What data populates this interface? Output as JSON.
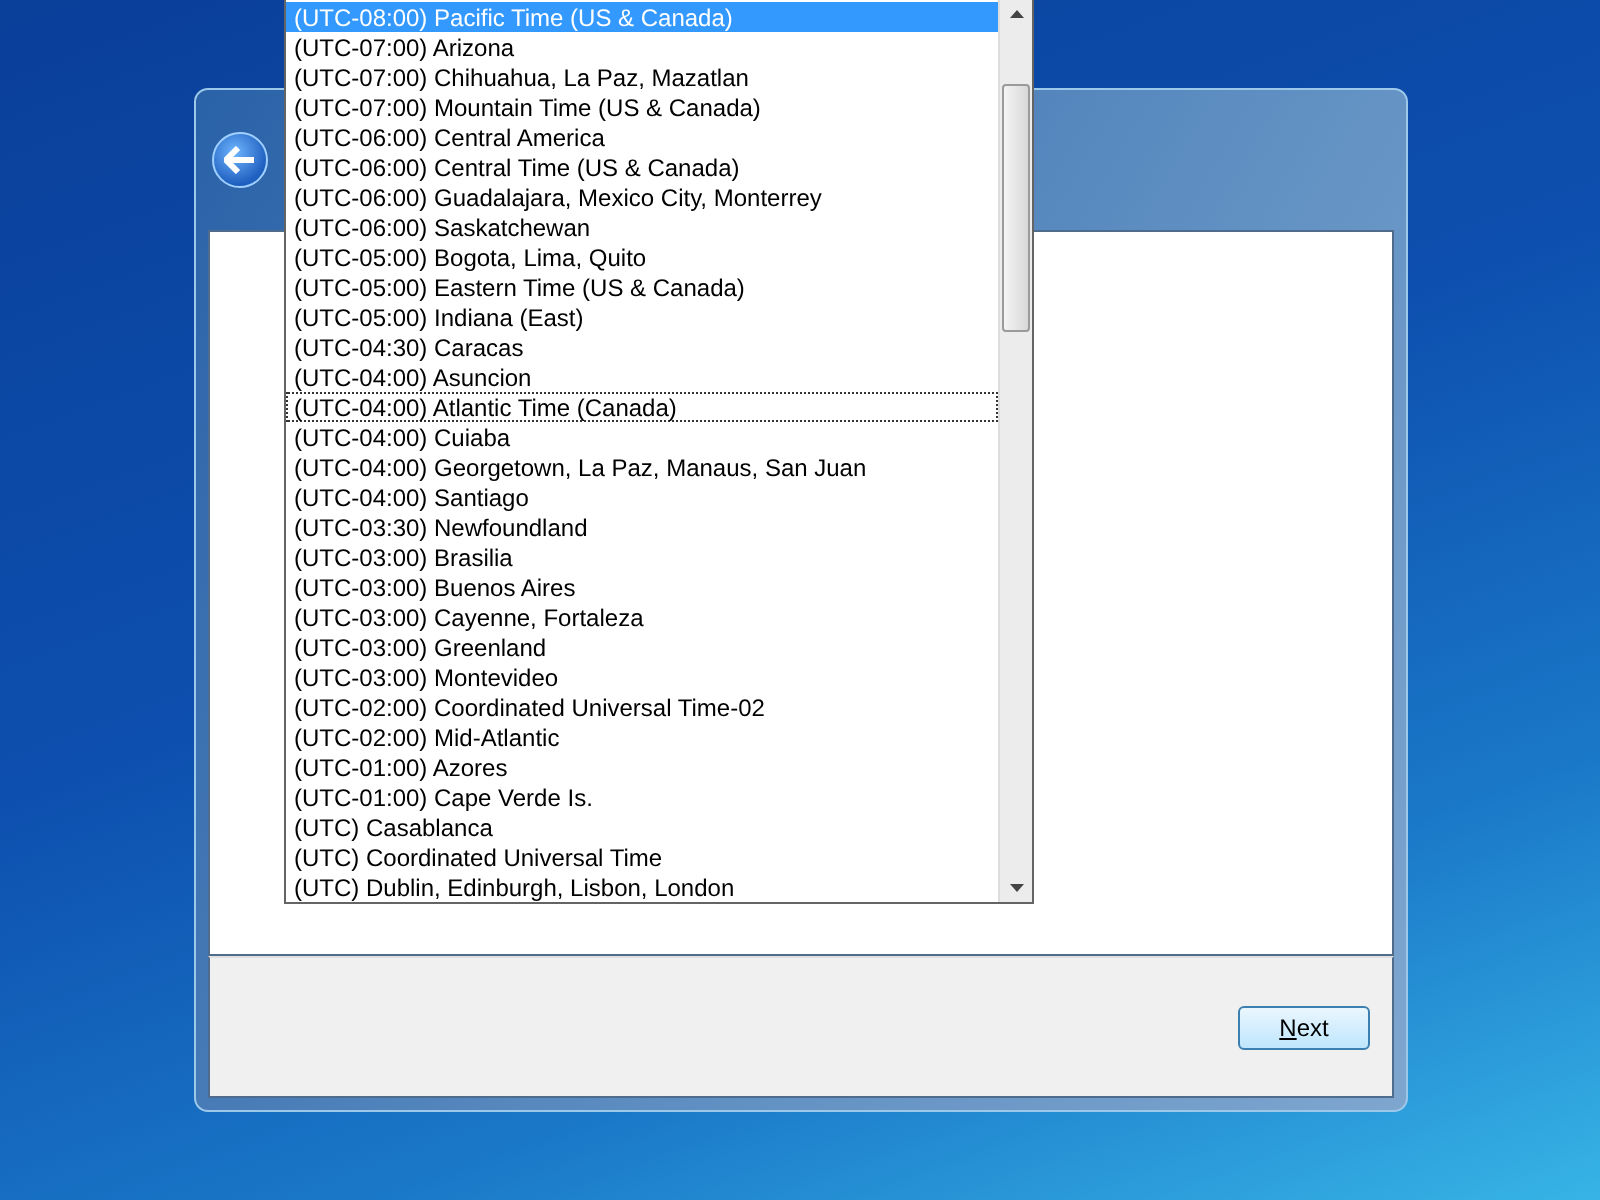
{
  "timezone_list": {
    "items": [
      {
        "label": "(UTC-08:00) Pacific Time (US & Canada)",
        "selected": true,
        "focused": false
      },
      {
        "label": "(UTC-07:00) Arizona",
        "selected": false,
        "focused": false
      },
      {
        "label": "(UTC-07:00) Chihuahua, La Paz, Mazatlan",
        "selected": false,
        "focused": false
      },
      {
        "label": "(UTC-07:00) Mountain Time (US & Canada)",
        "selected": false,
        "focused": false
      },
      {
        "label": "(UTC-06:00) Central America",
        "selected": false,
        "focused": false
      },
      {
        "label": "(UTC-06:00) Central Time (US & Canada)",
        "selected": false,
        "focused": false
      },
      {
        "label": "(UTC-06:00) Guadalajara, Mexico City, Monterrey",
        "selected": false,
        "focused": false
      },
      {
        "label": "(UTC-06:00) Saskatchewan",
        "selected": false,
        "focused": false
      },
      {
        "label": "(UTC-05:00) Bogota, Lima, Quito",
        "selected": false,
        "focused": false
      },
      {
        "label": "(UTC-05:00) Eastern Time (US & Canada)",
        "selected": false,
        "focused": false
      },
      {
        "label": "(UTC-05:00) Indiana (East)",
        "selected": false,
        "focused": false
      },
      {
        "label": "(UTC-04:30) Caracas",
        "selected": false,
        "focused": false
      },
      {
        "label": "(UTC-04:00) Asuncion",
        "selected": false,
        "focused": false
      },
      {
        "label": "(UTC-04:00) Atlantic Time (Canada)",
        "selected": false,
        "focused": true
      },
      {
        "label": "(UTC-04:00) Cuiaba",
        "selected": false,
        "focused": false
      },
      {
        "label": "(UTC-04:00) Georgetown, La Paz, Manaus, San Juan",
        "selected": false,
        "focused": false
      },
      {
        "label": "(UTC-04:00) Santiago",
        "selected": false,
        "focused": false
      },
      {
        "label": "(UTC-03:30) Newfoundland",
        "selected": false,
        "focused": false
      },
      {
        "label": "(UTC-03:00) Brasilia",
        "selected": false,
        "focused": false
      },
      {
        "label": "(UTC-03:00) Buenos Aires",
        "selected": false,
        "focused": false
      },
      {
        "label": "(UTC-03:00) Cayenne, Fortaleza",
        "selected": false,
        "focused": false
      },
      {
        "label": "(UTC-03:00) Greenland",
        "selected": false,
        "focused": false
      },
      {
        "label": "(UTC-03:00) Montevideo",
        "selected": false,
        "focused": false
      },
      {
        "label": "(UTC-02:00) Coordinated Universal Time-02",
        "selected": false,
        "focused": false
      },
      {
        "label": "(UTC-02:00) Mid-Atlantic",
        "selected": false,
        "focused": false
      },
      {
        "label": "(UTC-01:00) Azores",
        "selected": false,
        "focused": false
      },
      {
        "label": "(UTC-01:00) Cape Verde Is.",
        "selected": false,
        "focused": false
      },
      {
        "label": "(UTC) Casablanca",
        "selected": false,
        "focused": false
      },
      {
        "label": "(UTC) Coordinated Universal Time",
        "selected": false,
        "focused": false
      },
      {
        "label": "(UTC) Dublin, Edinburgh, Lisbon, London",
        "selected": false,
        "focused": false
      }
    ]
  },
  "footer": {
    "next_button": "Next"
  }
}
